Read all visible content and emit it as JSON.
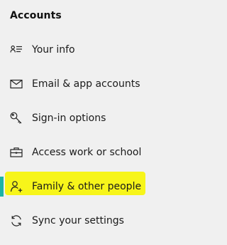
{
  "section": {
    "title": "Accounts"
  },
  "nav": {
    "items": [
      {
        "label": "Your info",
        "icon": "contact-card-icon",
        "selected": false
      },
      {
        "label": "Email & app accounts",
        "icon": "mail-icon",
        "selected": false
      },
      {
        "label": "Sign-in options",
        "icon": "key-icon",
        "selected": false
      },
      {
        "label": "Access work or school",
        "icon": "briefcase-icon",
        "selected": false
      },
      {
        "label": "Family & other people",
        "icon": "add-person-icon",
        "selected": true
      },
      {
        "label": "Sync your settings",
        "icon": "sync-icon",
        "selected": false
      }
    ]
  },
  "colors": {
    "background": "#f0f0f0",
    "accent": "#1db3a6",
    "highlight": "#f7f51a"
  }
}
